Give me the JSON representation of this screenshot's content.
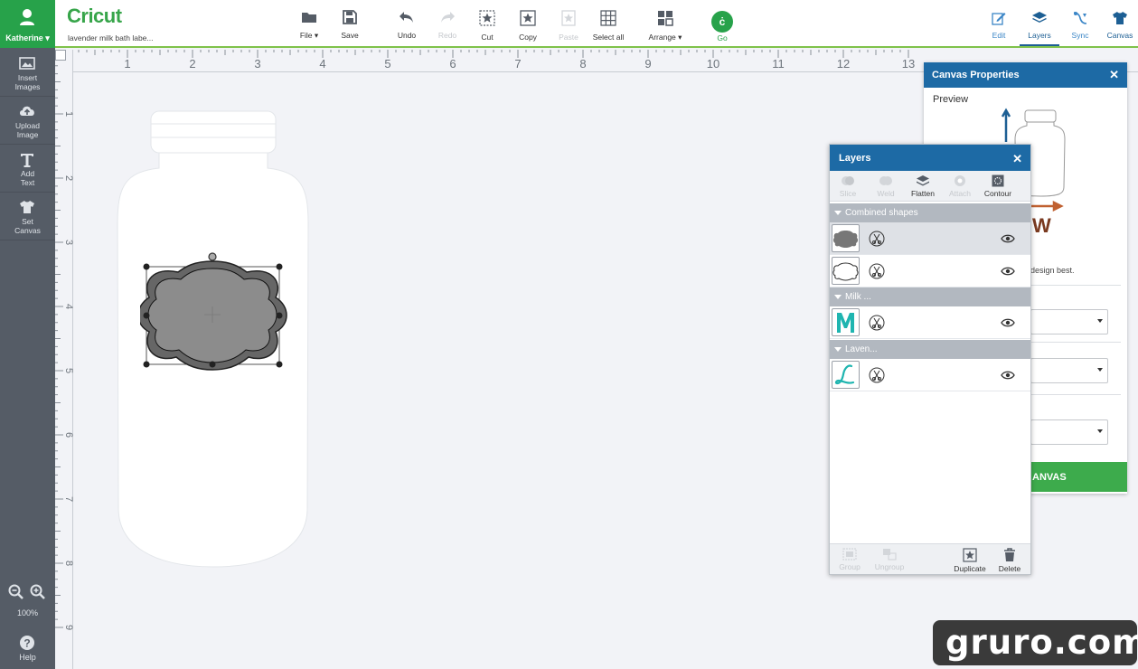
{
  "user": {
    "name": "Katherine",
    "icon": "user-icon"
  },
  "sidebar": {
    "items": [
      {
        "label": "Insert\nImages",
        "icon": "image-icon"
      },
      {
        "label": "Upload\nImage",
        "icon": "upload-icon"
      },
      {
        "label": "Add\nText",
        "icon": "text-icon"
      },
      {
        "label": "Set\nCanvas",
        "icon": "shirt-icon"
      }
    ],
    "zoom": "100%",
    "help": "Help"
  },
  "topbar": {
    "logo": "Cricut",
    "project_name": "lavender milk bath labe...",
    "tools": {
      "file": "File",
      "save": "Save",
      "undo": "Undo",
      "redo": "Redo",
      "cut": "Cut",
      "copy": "Copy",
      "paste": "Paste",
      "select_all": "Select all",
      "arrange": "Arrange",
      "go": "Go"
    },
    "right_tabs": {
      "edit": "Edit",
      "layers": "Layers",
      "sync": "Sync",
      "canvas": "Canvas"
    }
  },
  "ruler": {
    "top": [
      "1",
      "2",
      "3",
      "4",
      "5",
      "6",
      "7",
      "8",
      "9",
      "10",
      "11",
      "12",
      "13"
    ],
    "left": [
      "1",
      "2",
      "3",
      "4",
      "5",
      "6",
      "7",
      "8",
      "9"
    ]
  },
  "canvas_panel": {
    "title": "Canvas Properties",
    "preview_label": "Preview",
    "description": "design best.",
    "apply_label": "ANVAS"
  },
  "layers_panel": {
    "title": "Layers",
    "toolbar": {
      "slice": "Slice",
      "weld": "Weld",
      "flatten": "Flatten",
      "attach": "Attach",
      "contour": "Contour"
    },
    "groups": [
      {
        "label": "Combined shapes"
      },
      {
        "label": "Milk ..."
      },
      {
        "label": "Laven..."
      }
    ],
    "bottom": {
      "group": "Group",
      "ungroup": "Ungroup",
      "duplicate": "Duplicate",
      "delete": "Delete"
    }
  },
  "colors": {
    "brand_green": "#27a24a",
    "panel_blue": "#1d6aa5",
    "teal_accent": "#1fb5b0"
  },
  "watermark": "gruro.com"
}
